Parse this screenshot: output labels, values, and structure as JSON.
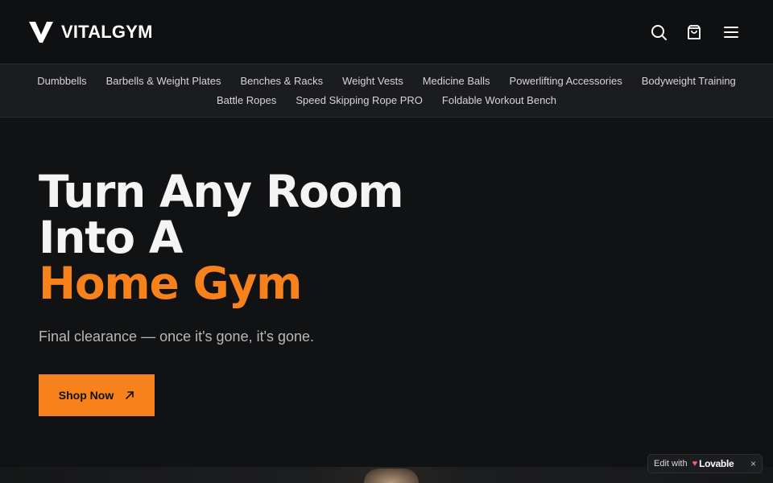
{
  "header": {
    "brand": "VITALGYM",
    "icons": [
      "search-icon",
      "cart-icon",
      "menu-icon"
    ]
  },
  "subnav": {
    "row1": [
      "Dumbbells",
      "Barbells & Weight Plates",
      "Benches & Racks",
      "Weight Vests",
      "Medicine Balls",
      "Powerlifting Accessories",
      "Bodyweight Training"
    ],
    "row2": [
      "Battle Ropes",
      "Speed Skipping Rope PRO",
      "Foldable Workout Bench"
    ]
  },
  "hero": {
    "title_line1": "Turn Any Room",
    "title_line2": "Into A",
    "title_highlight": "Home Gym",
    "subtitle": "Final clearance — once it's gone, it's gone.",
    "cta_label": "Shop Now"
  },
  "badge": {
    "prefix": "Edit with",
    "brand": "Lovable",
    "close": "×"
  },
  "colors": {
    "accent": "#f7821b",
    "background": "#111214",
    "subnav_bg": "#1b1c1f"
  }
}
